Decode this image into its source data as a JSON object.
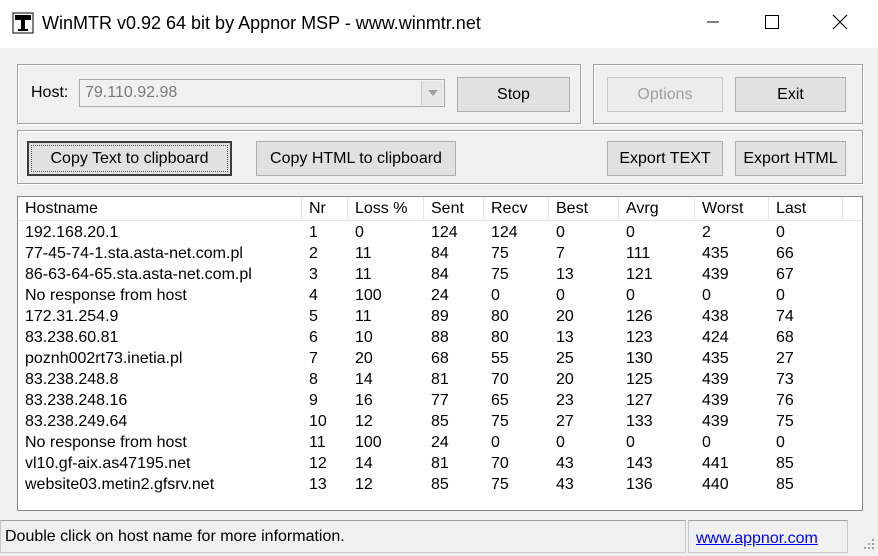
{
  "window": {
    "title": "WinMTR v0.92 64 bit by Appnor MSP - www.winmtr.net"
  },
  "host": {
    "label": "Host:",
    "value": "79.110.92.98"
  },
  "buttons": {
    "stop": "Stop",
    "options": "Options",
    "exit": "Exit",
    "copy_text": "Copy Text to clipboard",
    "copy_html": "Copy HTML to clipboard",
    "export_text": "Export TEXT",
    "export_html": "Export HTML"
  },
  "table": {
    "columns": [
      "Hostname",
      "Nr",
      "Loss %",
      "Sent",
      "Recv",
      "Best",
      "Avrg",
      "Worst",
      "Last"
    ],
    "rows": [
      [
        "192.168.20.1",
        "1",
        "0",
        "124",
        "124",
        "0",
        "0",
        "2",
        "0"
      ],
      [
        "77-45-74-1.sta.asta-net.com.pl",
        "2",
        "11",
        "84",
        "75",
        "7",
        "111",
        "435",
        "66"
      ],
      [
        "86-63-64-65.sta.asta-net.com.pl",
        "3",
        "11",
        "84",
        "75",
        "13",
        "121",
        "439",
        "67"
      ],
      [
        "No response from host",
        "4",
        "100",
        "24",
        "0",
        "0",
        "0",
        "0",
        "0"
      ],
      [
        "172.31.254.9",
        "5",
        "11",
        "89",
        "80",
        "20",
        "126",
        "438",
        "74"
      ],
      [
        "83.238.60.81",
        "6",
        "10",
        "88",
        "80",
        "13",
        "123",
        "424",
        "68"
      ],
      [
        "poznh002rt73.inetia.pl",
        "7",
        "20",
        "68",
        "55",
        "25",
        "130",
        "435",
        "27"
      ],
      [
        "83.238.248.8",
        "8",
        "14",
        "81",
        "70",
        "20",
        "125",
        "439",
        "73"
      ],
      [
        "83.238.248.16",
        "9",
        "16",
        "77",
        "65",
        "23",
        "127",
        "439",
        "76"
      ],
      [
        "83.238.249.64",
        "10",
        "12",
        "85",
        "75",
        "27",
        "133",
        "439",
        "75"
      ],
      [
        "No response from host",
        "11",
        "100",
        "24",
        "0",
        "0",
        "0",
        "0",
        "0"
      ],
      [
        "vl10.gf-aix.as47195.net",
        "12",
        "14",
        "81",
        "70",
        "43",
        "143",
        "441",
        "85"
      ],
      [
        "website03.metin2.gfsrv.net",
        "13",
        "12",
        "85",
        "75",
        "43",
        "136",
        "440",
        "85"
      ]
    ]
  },
  "status": {
    "message": "Double click on host name for more information.",
    "link": "www.appnor.com"
  },
  "icons": {
    "app": "winmtr-app-icon",
    "minimize": "minimize-icon",
    "maximize": "maximize-icon",
    "close": "close-icon",
    "dropdown": "chevron-down-icon",
    "grip": "resize-grip-icon"
  }
}
